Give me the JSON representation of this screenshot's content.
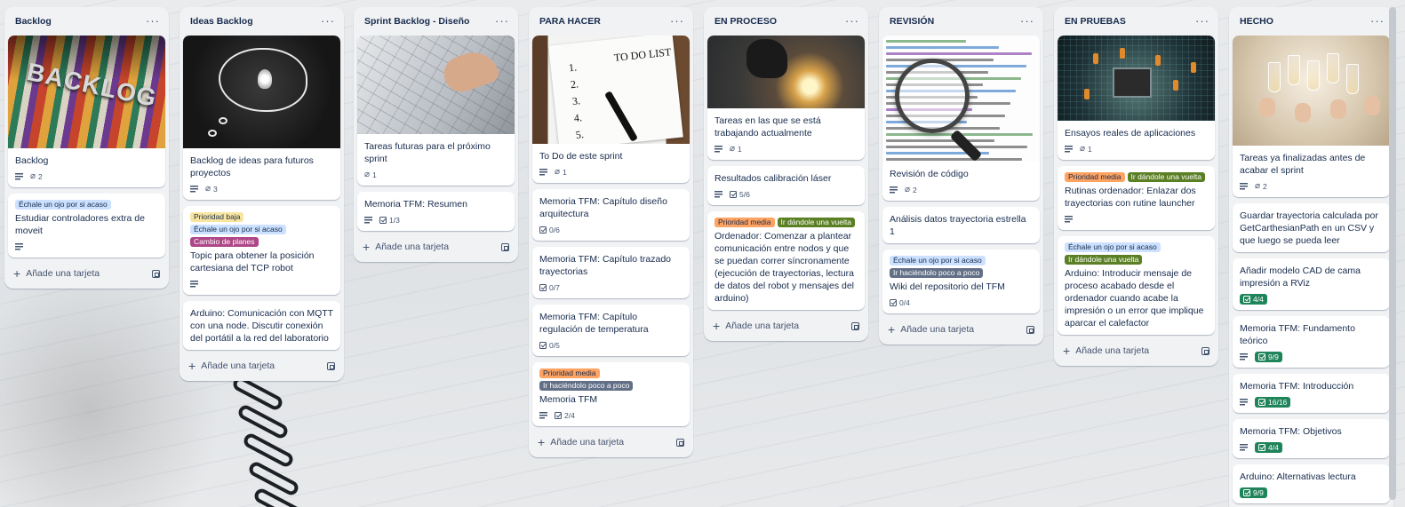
{
  "lists": [
    {
      "title": "Backlog",
      "add_card": "Añade una tarjeta",
      "cards": [
        {
          "title": "Backlog",
          "cover": "backlog-cover-image",
          "labels": [],
          "badges": {
            "description": true,
            "attachments": "2"
          }
        },
        {
          "title": "Estudiar controladores extra de moveit",
          "labels": [
            {
              "text": "Échale un ojo por si acaso",
              "color": "#cce0ff"
            }
          ],
          "badges": {
            "description": true
          }
        }
      ]
    },
    {
      "title": "Ideas Backlog",
      "add_card": "Añade una tarjeta",
      "cards": [
        {
          "title": "Backlog de ideas para futuros proyectos",
          "cover": "lightbulb-cover-image",
          "labels": [],
          "badges": {
            "description": true,
            "attachments": "3"
          }
        },
        {
          "title": "Topic para obtener la posición cartesiana del TCP robot",
          "labels": [
            {
              "text": "Prioridad baja",
              "color": "#f8e6a0"
            },
            {
              "text": "Échale un ojo por si acaso",
              "color": "#cce0ff"
            },
            {
              "text": "Cambio de planes",
              "color": "#ae4787",
              "text_color": "#ffffff"
            }
          ],
          "badges": {
            "description": true
          }
        },
        {
          "title": "Arduino: Comunicación con MQTT con una node. Discutir conexión del portátil a la red del laboratorio",
          "labels": [],
          "badges": {}
        }
      ]
    },
    {
      "title": "Sprint Backlog - Diseño",
      "add_card": "Añade una tarjeta",
      "cards": [
        {
          "title": "Tareas futuras para el próximo sprint",
          "cover": "blueprint-cover-image",
          "labels": [],
          "badges": {
            "attachments": "1"
          }
        },
        {
          "title": "Memoria TFM: Resumen",
          "labels": [],
          "badges": {
            "description": true,
            "checklist": "1/3"
          }
        }
      ]
    },
    {
      "title": "PARA HACER",
      "add_card": "Añade una tarjeta",
      "cards": [
        {
          "title": "To Do de este sprint",
          "cover": "todo-list-cover-image",
          "labels": [],
          "badges": {
            "description": true,
            "attachments": "1"
          }
        },
        {
          "title": "Memoria TFM: Capítulo diseño arquitectura",
          "labels": [],
          "badges": {
            "checklist": "0/6"
          }
        },
        {
          "title": "Memoria TFM: Capítulo trazado trayectorias",
          "labels": [],
          "badges": {
            "checklist": "0/7"
          }
        },
        {
          "title": "Memoria TFM: Capítulo regulación de temperatura",
          "labels": [],
          "badges": {
            "checklist": "0/5"
          }
        },
        {
          "title": "Memoria TFM",
          "labels": [
            {
              "text": "Prioridad media",
              "color": "#fea362"
            },
            {
              "text": "Ir haciéndolo poco a poco",
              "color": "#626f86",
              "text_color": "#ffffff"
            }
          ],
          "badges": {
            "description": true,
            "checklist": "2/4"
          }
        }
      ]
    },
    {
      "title": "EN PROCESO",
      "add_card": "Añade una tarjeta",
      "cards": [
        {
          "title": "Tareas en las que se está trabajando actualmente",
          "cover": "welder-cover-image",
          "labels": [],
          "badges": {
            "description": true,
            "attachments": "1"
          }
        },
        {
          "title": "Resultados calibración láser",
          "labels": [],
          "badges": {
            "description": true,
            "checklist": "5/6"
          }
        },
        {
          "title": "Ordenador: Comenzar a plantear comunicación entre nodos y que se puedan correr síncronamente (ejecución de trayectorias, lectura de datos del robot y mensajes del arduino)",
          "labels": [
            {
              "text": "Prioridad media",
              "color": "#fea362"
            },
            {
              "text": "Ir dándole una vuelta",
              "color": "#5b7f24",
              "text_color": "#ffffff"
            }
          ],
          "badges": {}
        }
      ]
    },
    {
      "title": "REVISIÓN",
      "add_card": "Añade una tarjeta",
      "cards": [
        {
          "title": "Revisión de código",
          "cover": "code-magnifier-cover-image",
          "labels": [],
          "badges": {
            "description": true,
            "attachments": "2"
          }
        },
        {
          "title": "Análisis datos trayectoria estrella 1",
          "labels": [],
          "badges": {}
        },
        {
          "title": "Wiki del repositorio del TFM",
          "labels": [
            {
              "text": "Échale un ojo por si acaso",
              "color": "#cce0ff"
            },
            {
              "text": "Ir haciéndolo poco a poco",
              "color": "#626f86",
              "text_color": "#ffffff"
            }
          ],
          "badges": {
            "checklist": "0/4"
          }
        }
      ]
    },
    {
      "title": "EN PRUEBAS",
      "add_card": "Añade una tarjeta",
      "cards": [
        {
          "title": "Ensayos reales de aplicaciones",
          "cover": "circuit-board-cover-image",
          "labels": [],
          "badges": {
            "description": true,
            "attachments": "1"
          }
        },
        {
          "title": "Rutinas ordenador: Enlazar dos trayectorias con rutine launcher",
          "labels": [
            {
              "text": "Prioridad media",
              "color": "#fea362"
            },
            {
              "text": "Ir dándole una vuelta",
              "color": "#5b7f24",
              "text_color": "#ffffff"
            }
          ],
          "badges": {
            "description": true
          }
        },
        {
          "title": "Arduino: Introducir mensaje de proceso acabado desde el ordenador cuando acabe la impresión o un error que implique aparcar el calefactor",
          "labels": [
            {
              "text": "Échale un ojo por si acaso",
              "color": "#cce0ff"
            },
            {
              "text": "Ir dándole una vuelta",
              "color": "#5b7f24",
              "text_color": "#ffffff"
            }
          ],
          "badges": {}
        }
      ]
    },
    {
      "title": "HECHO",
      "add_card": "",
      "cards": [
        {
          "title": "Tareas ya finalizadas antes de acabar el sprint",
          "cover": "toast-cover-image",
          "labels": [],
          "badges": {
            "description": true,
            "attachments": "2"
          }
        },
        {
          "title": "Guardar trayectoria calculada por GetCarthesianPath en un CSV y que luego se pueda leer",
          "labels": [],
          "badges": {}
        },
        {
          "title": "Añadir modelo CAD de cama impresión a RViz",
          "labels": [],
          "badges": {
            "checklist_done": "4/4"
          }
        },
        {
          "title": "Memoria TFM: Fundamento teórico",
          "labels": [],
          "badges": {
            "description": true,
            "checklist_done": "9/9"
          }
        },
        {
          "title": "Memoria TFM: Introducción",
          "labels": [],
          "badges": {
            "description": true,
            "checklist_done": "16/16"
          }
        },
        {
          "title": "Memoria TFM: Objetivos",
          "labels": [],
          "badges": {
            "description": true,
            "checklist_done": "4/4"
          }
        },
        {
          "title": "Arduino: Alternativas lectura",
          "labels": [],
          "badges": {
            "checklist_done": "9/9"
          }
        }
      ]
    }
  ],
  "cover_text": {
    "backlog": "BACKLOG",
    "todo": "TO DO LIST"
  },
  "menu_glyph": "···",
  "plus_glyph": "+",
  "clip_glyph": "⌀"
}
